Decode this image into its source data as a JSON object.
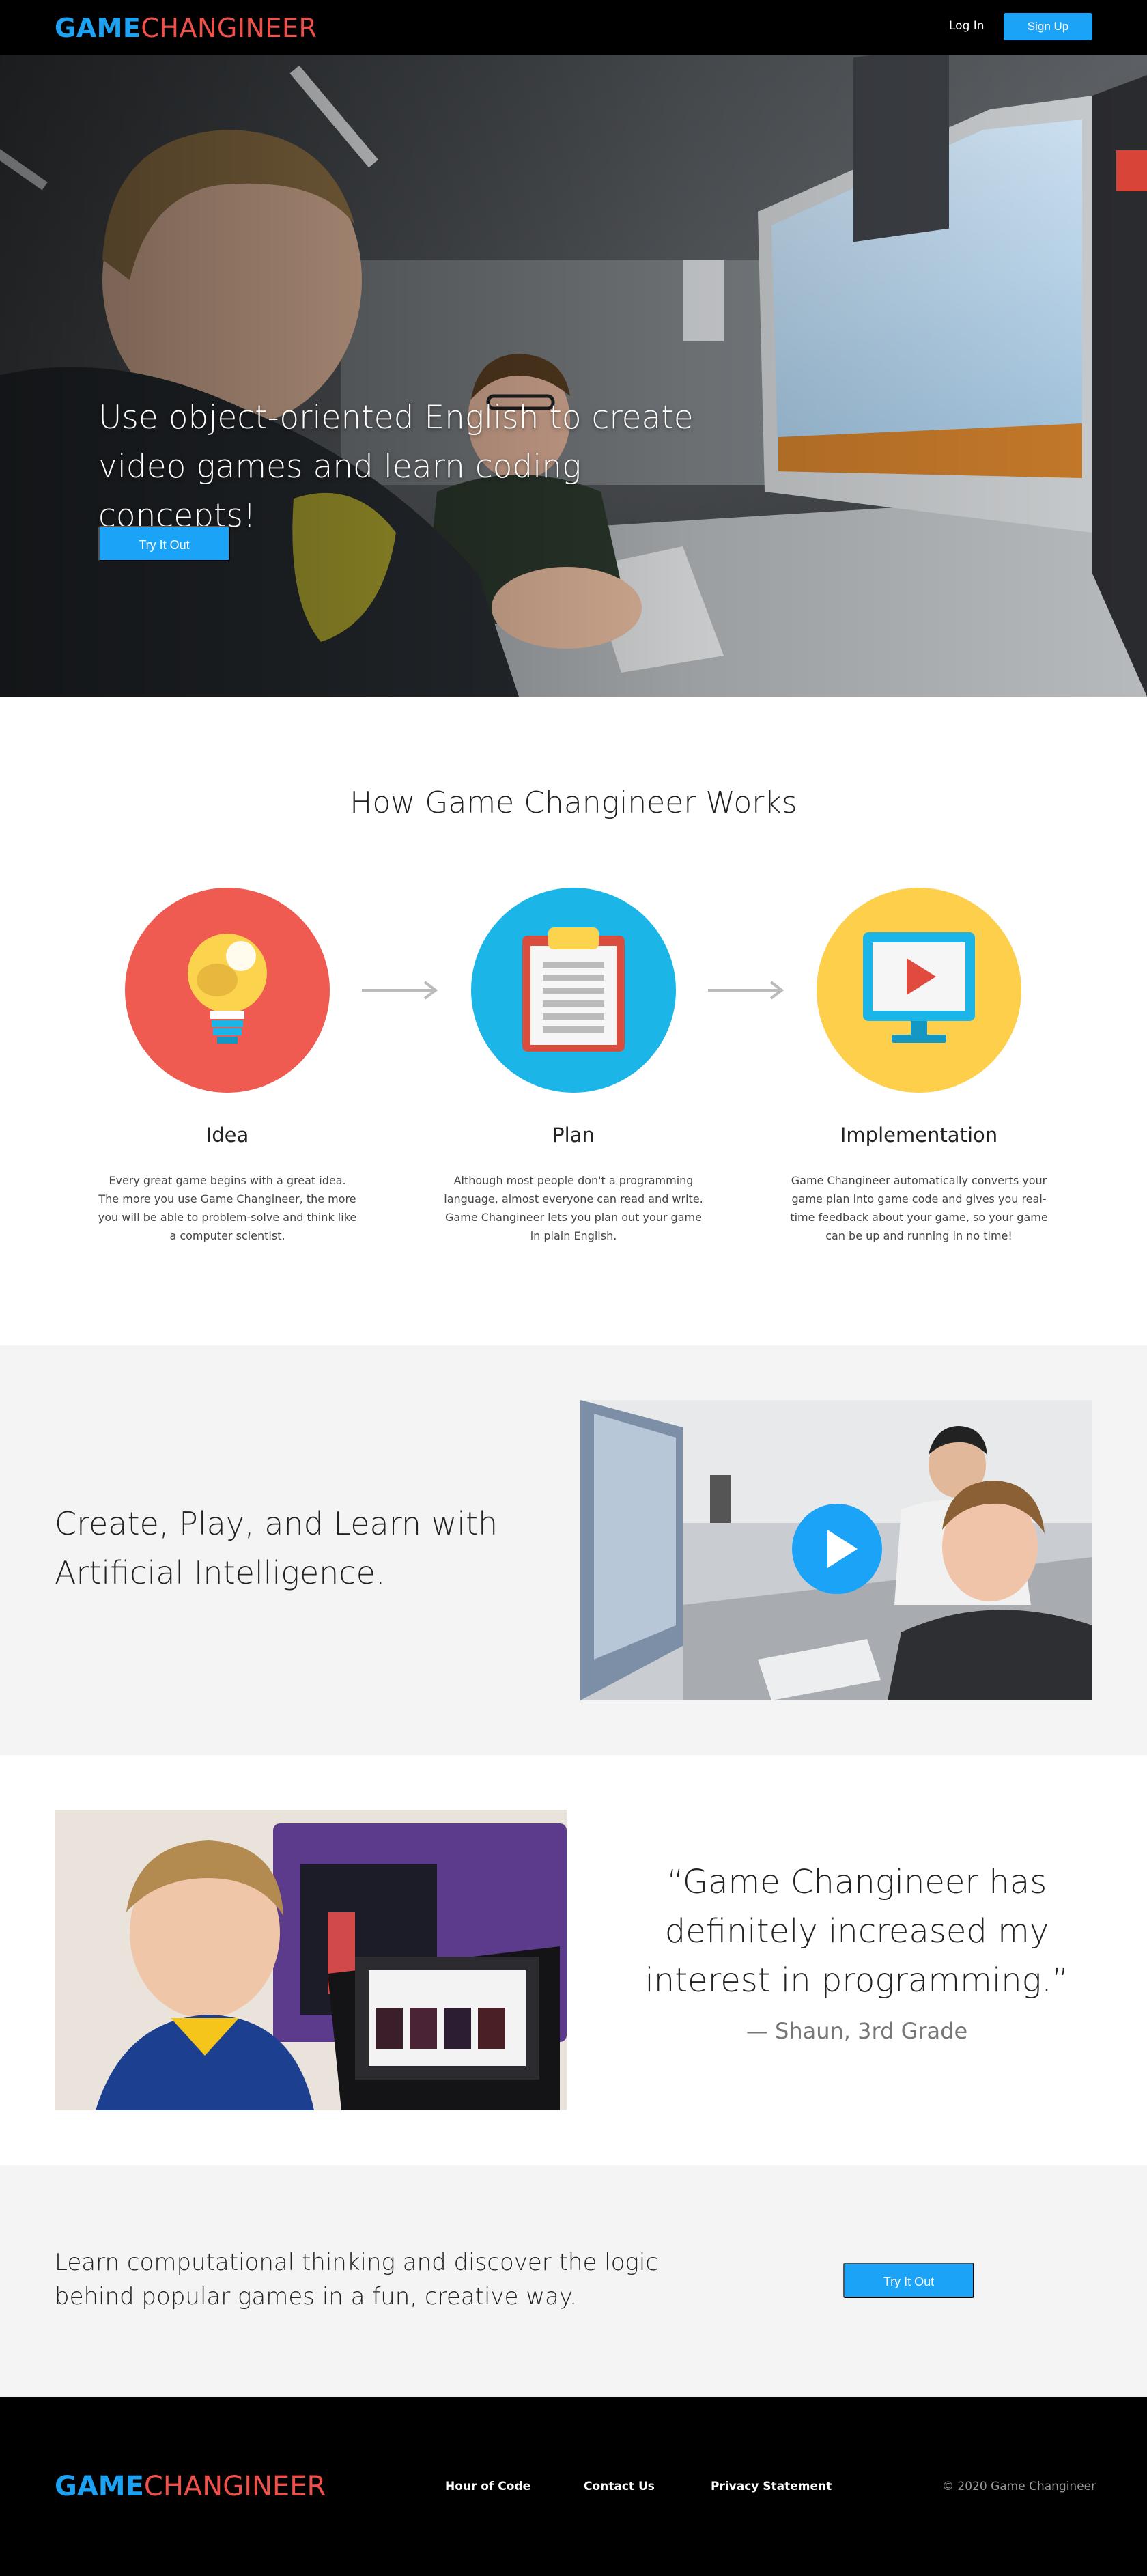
{
  "header": {
    "logo_part1": "GAME",
    "logo_part2": "CHANGINEER",
    "login_label": "Log In",
    "signup_label": "Sign Up"
  },
  "hero": {
    "headline": "Use object-oriented English to create video games and learn coding concepts!",
    "cta_label": "Try It Out"
  },
  "how_it_works": {
    "title": "How Game Changineer Works",
    "steps": [
      {
        "title": "Idea",
        "icon": "lightbulb-icon",
        "color": "#ef5a51",
        "description": "Every great game begins with a great idea. The more you use Game Changineer, the more you will be able to problem-solve and think like a computer scientist."
      },
      {
        "title": "Plan",
        "icon": "clipboard-icon",
        "color": "#1cb5e8",
        "description": "Although most people don't a programming language, almost everyone can read and write. Game Changineer lets you plan out your game in plain English."
      },
      {
        "title": "Implementation",
        "icon": "monitor-play-icon",
        "color": "#fdcf4a",
        "description": "Game Changineer automatically converts your game plan into game code and gives you real-time feedback about your game, so your game can be up and running in no time!"
      }
    ]
  },
  "ai_section": {
    "headline": "Create, Play, and Learn with Artificial Intelligence."
  },
  "testimonial": {
    "quote": "“Game Changineer has definitely increased my interest in programming.”",
    "attribution": "— Shaun, 3rd Grade"
  },
  "cta": {
    "text": "Learn computational thinking and discover the logic behind popular games in a fun, creative way.",
    "button_label": "Try It Out"
  },
  "footer": {
    "logo_part1": "GAME",
    "logo_part2": "CHANGINEER",
    "links": [
      "Hour of Code",
      "Contact Us",
      "Privacy Statement"
    ],
    "copyright": "© 2020 Game Changineer"
  },
  "colors": {
    "accent_blue": "#1ba3f7",
    "brand_red": "#f0504a",
    "section_gray": "#f4f4f4"
  }
}
